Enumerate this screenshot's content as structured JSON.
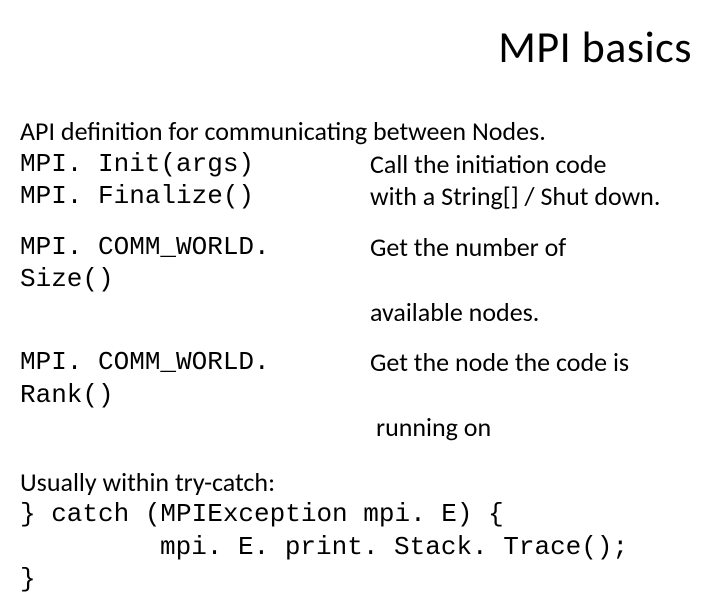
{
  "title": "MPI  basics",
  "intro": "API definition for communicating between Nodes.",
  "r1": {
    "code": "MPI. Init(args)",
    "desc": "Call the initiation code"
  },
  "r2": {
    "code": "MPI. Finalize()",
    "desc": "with a String[] / Shut down."
  },
  "r3": {
    "code": "MPI. COMM_WORLD. Size()",
    "desc_a": "Get the number of",
    "desc_b": "available nodes."
  },
  "r4": {
    "code": "MPI. COMM_WORLD. Rank()",
    "desc_a": "Get the node the code is",
    "desc_b": "running on"
  },
  "usually": "Usually within try-catch:",
  "code1": "} catch (MPIException mpi. E) {",
  "code2": "mpi. E. print. Stack. Trace();",
  "code3": "}"
}
